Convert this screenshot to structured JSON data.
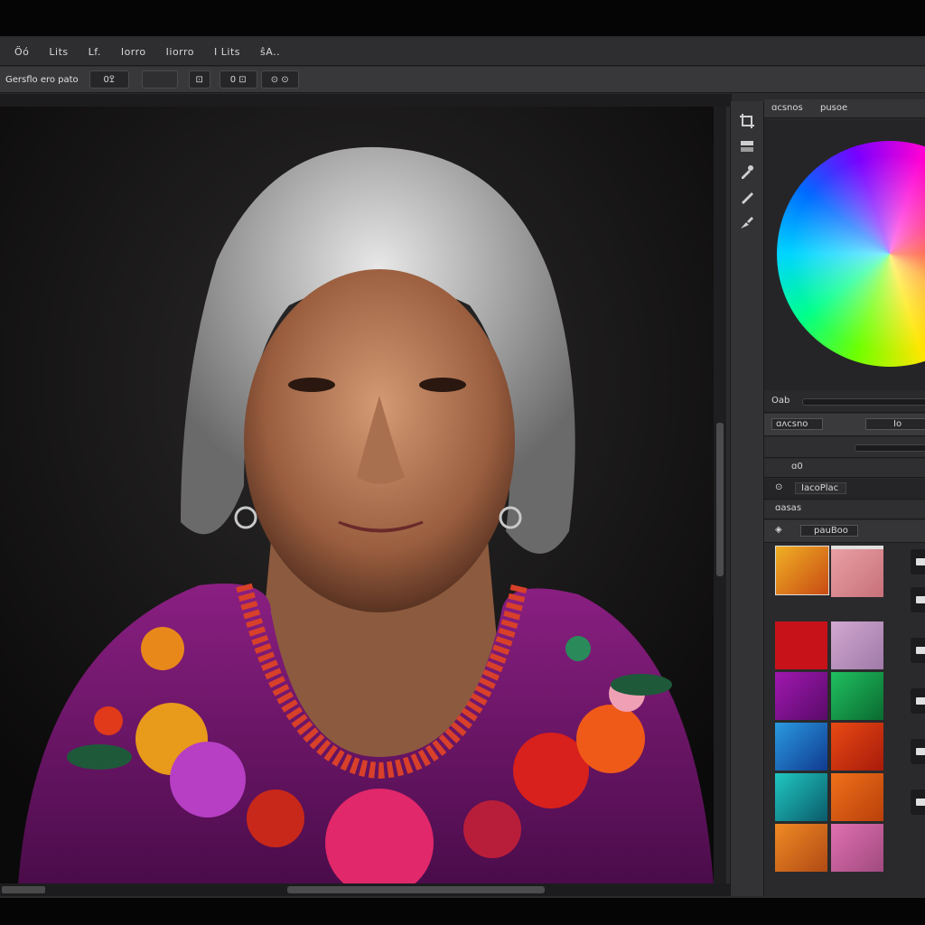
{
  "menu": {
    "items": [
      "Ӧó",
      "Lits",
      "Lf.",
      "Iorro",
      "Iiorro",
      "I Lits",
      "ŝA.."
    ]
  },
  "options_bar": {
    "preset_label": "Gersflo ero pato",
    "field_value": "ߐ0",
    "btn_a": "⊡",
    "btn_b": "0 ⊡",
    "btn_c": "⊙ ⊙"
  },
  "panel": {
    "tab_1": "ɑcsnos",
    "tab_2": "pusoe",
    "wheel_row_label": "Oab",
    "layers_label": "ɑʌcsno",
    "layers_value": "Io",
    "row_a_label": "ɑ0",
    "row_b_label": "IacoPlac",
    "row_c_label": "ɑasas",
    "row_d_label": "pauBoo"
  },
  "tools": [
    "crop-icon",
    "layers-icon",
    "dropper-icon",
    "brush-icon",
    "pen-icon"
  ],
  "swatches": {
    "col_a": [
      "#e08a1c",
      "#c8121a",
      "#8a0fa0",
      "#1b6fc0",
      "#11a4a0",
      "#d2621a"
    ],
    "col_b": [
      "#e08b8f",
      "#c996c2",
      "#18b25a",
      "#d53a10",
      "#d2621a",
      "#d25aa0"
    ]
  },
  "accent_colors": {
    "panel_bg": "#2a2a2c",
    "menubar_bg": "#2e2e30",
    "canvas_bg": "#0f0e0e"
  }
}
